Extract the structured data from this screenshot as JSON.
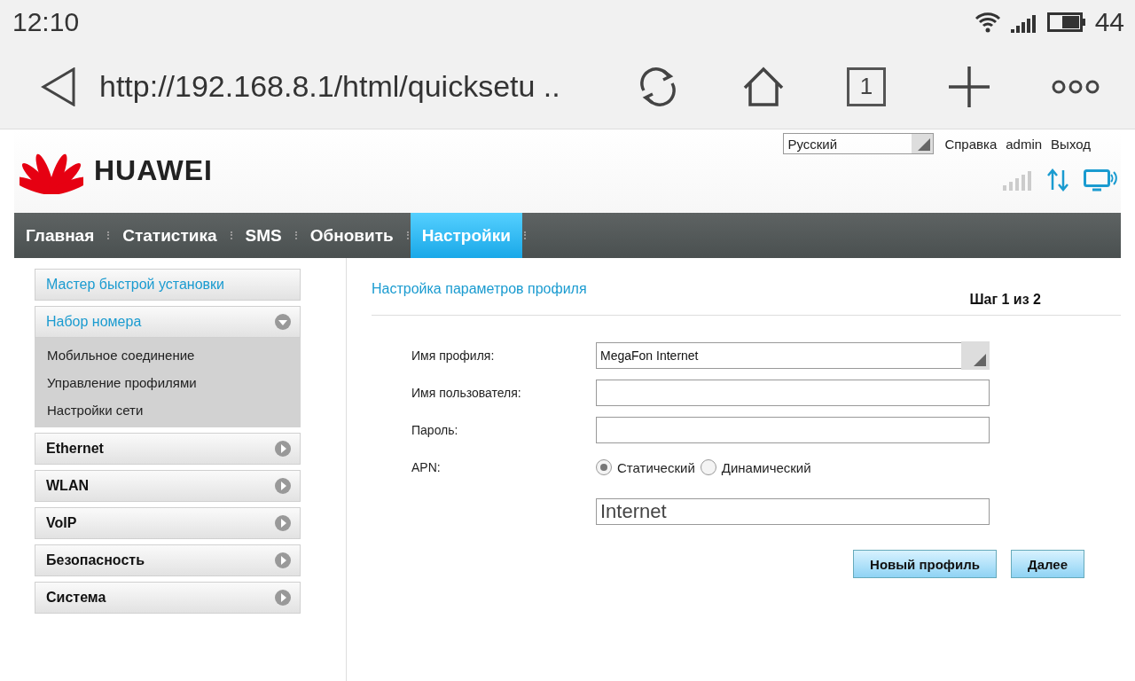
{
  "status_bar": {
    "time": "12:10",
    "battery": "44"
  },
  "browser": {
    "url": "http://192.168.8.1/html/quicksetu ..",
    "tab_count": "1"
  },
  "header": {
    "language": "Русский",
    "links": [
      "Справка",
      "admin",
      "Выход"
    ],
    "logo": "HUAWEI"
  },
  "nav": [
    {
      "label": "Главная",
      "selected": false
    },
    {
      "label": "Статистика",
      "selected": false
    },
    {
      "label": "SMS",
      "selected": false
    },
    {
      "label": "Обновить",
      "selected": false
    },
    {
      "label": "Настройки",
      "selected": true
    }
  ],
  "sidebar": {
    "items": [
      {
        "label": "Мастер быстрой установки",
        "kind": "link",
        "selected": true
      },
      {
        "label": "Набор номера",
        "kind": "group",
        "selected": true,
        "expanded": true,
        "children": [
          {
            "label": "Мобильное соединение"
          },
          {
            "label": "Управление профилями"
          },
          {
            "label": "Настройки сети"
          }
        ]
      },
      {
        "label": "Ethernet",
        "kind": "group",
        "selected": false,
        "expanded": false
      },
      {
        "label": "WLAN",
        "kind": "group",
        "selected": false,
        "expanded": false
      },
      {
        "label": "VoIP",
        "kind": "group",
        "selected": false,
        "expanded": false
      },
      {
        "label": "Безопасность",
        "kind": "group",
        "selected": false,
        "expanded": false
      },
      {
        "label": "Система",
        "kind": "group",
        "selected": false,
        "expanded": false
      }
    ]
  },
  "content": {
    "title": "Настройка параметров профиля",
    "step": "Шаг 1 из 2",
    "fields": [
      {
        "kind": "select",
        "label": "Имя профиля:",
        "value": "MegaFon Internet"
      },
      {
        "kind": "text",
        "label": "Имя пользователя:"
      },
      {
        "kind": "text",
        "label": "Пароль:"
      },
      {
        "kind": "radio",
        "label": "APN:",
        "options": [
          {
            "label": "Статический",
            "selected": true
          },
          {
            "label": "Динамический",
            "selected": false
          }
        ]
      },
      {
        "kind": "text",
        "value": "Internet",
        "large": true
      }
    ],
    "buttons": [
      "Новый профиль",
      "Далее"
    ]
  }
}
